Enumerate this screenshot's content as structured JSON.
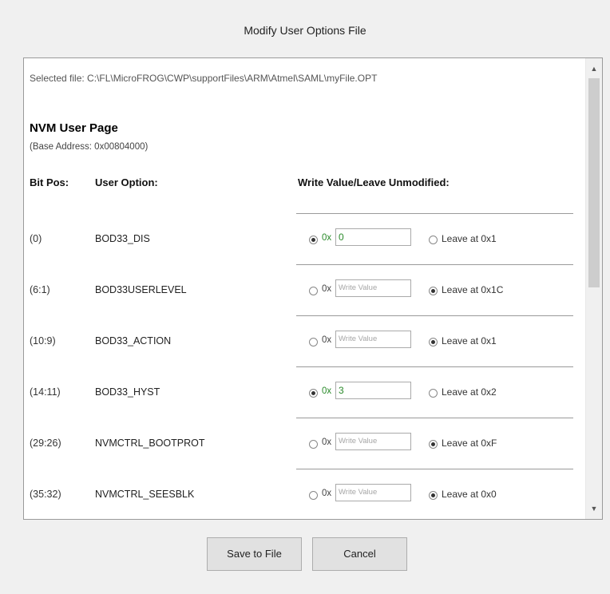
{
  "dialog": {
    "title": "Modify User Options File"
  },
  "selected_file": "Selected file: C:\\FL\\MicroFROG\\CWP\\supportFiles\\ARM\\Atmel\\SAML\\myFile.OPT",
  "section": {
    "title": "NVM User Page",
    "base_address": "(Base Address: 0x00804000)"
  },
  "headers": {
    "bit_pos": "Bit Pos:",
    "user_option": "User Option:",
    "write_value": "Write Value/Leave Unmodified:"
  },
  "placeholder": "Write Value",
  "rows": [
    {
      "bitpos": "(0)",
      "option": "BOD33_DIS",
      "prefix": "0x",
      "value": "0",
      "leave": "Leave at 0x1",
      "mode": "write"
    },
    {
      "bitpos": "(6:1)",
      "option": "BOD33USERLEVEL",
      "prefix": "0x",
      "value": "",
      "leave": "Leave at 0x1C",
      "mode": "leave"
    },
    {
      "bitpos": "(10:9)",
      "option": "BOD33_ACTION",
      "prefix": "0x",
      "value": "",
      "leave": "Leave at 0x1",
      "mode": "leave"
    },
    {
      "bitpos": "(14:11)",
      "option": "BOD33_HYST",
      "prefix": "0x",
      "value": "3",
      "leave": "Leave at 0x2",
      "mode": "write"
    },
    {
      "bitpos": "(29:26)",
      "option": "NVMCTRL_BOOTPROT",
      "prefix": "0x",
      "value": "",
      "leave": "Leave at 0xF",
      "mode": "leave"
    },
    {
      "bitpos": "(35:32)",
      "option": "NVMCTRL_SEESBLK",
      "prefix": "0x",
      "value": "",
      "leave": "Leave at 0x0",
      "mode": "leave"
    }
  ],
  "buttons": {
    "save": "Save to File",
    "cancel": "Cancel"
  }
}
